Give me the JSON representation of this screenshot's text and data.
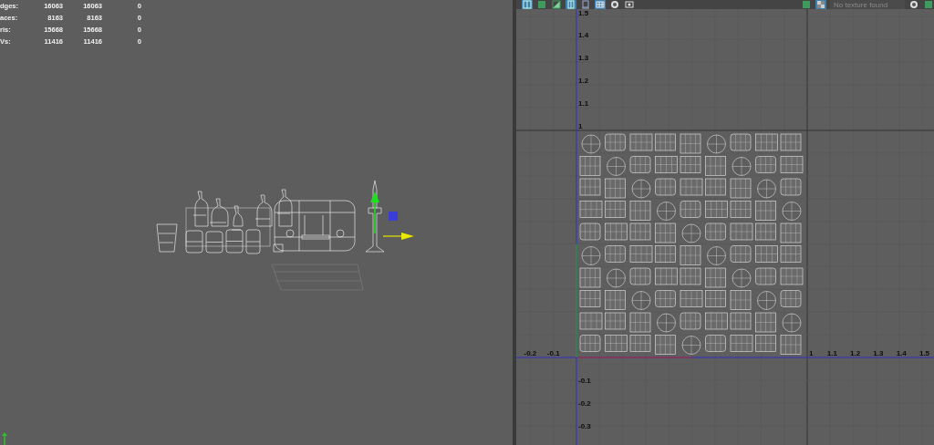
{
  "stats": [
    {
      "label": "dges:",
      "values": [
        "16063",
        "16063",
        "0"
      ]
    },
    {
      "label": "aces:",
      "values": [
        "8163",
        "8163",
        "0"
      ]
    },
    {
      "label": "ris:",
      "values": [
        "15668",
        "15668",
        "0"
      ]
    },
    {
      "label": "Vs:",
      "values": [
        "11416",
        "11416",
        "0"
      ]
    }
  ],
  "uv_toolbar": {
    "left_tools": [
      {
        "kind": "panes",
        "selected": true
      },
      {
        "kind": "green",
        "selected": false
      },
      {
        "kind": "shade",
        "selected": false
      },
      {
        "kind": "columns",
        "selected": true
      },
      {
        "kind": "frame",
        "selected": false
      },
      {
        "kind": "grid",
        "selected": true
      },
      {
        "kind": "sphere",
        "selected": false
      },
      {
        "kind": "camera",
        "selected": false
      }
    ],
    "right_tools": [
      {
        "kind": "green",
        "selected": false
      },
      {
        "kind": "checker",
        "selected": true
      }
    ],
    "texture_field": {
      "placeholder": "No texture found"
    },
    "end_tools": [
      {
        "kind": "sphere",
        "selected": false
      },
      {
        "kind": "green",
        "selected": false
      }
    ]
  },
  "uv_axes": {
    "v_upper_labels": [
      "1.5",
      "1.4",
      "1.3",
      "1.2",
      "1.1",
      "1"
    ],
    "v_lower_labels": [
      "-0.1",
      "-0.2",
      "-0.3"
    ],
    "u_left_labels": [
      "-0.2",
      "-0.1"
    ],
    "u_right_labels": [
      "1",
      "1.1",
      "1.2",
      "1.3",
      "1.4",
      "1.5"
    ]
  }
}
